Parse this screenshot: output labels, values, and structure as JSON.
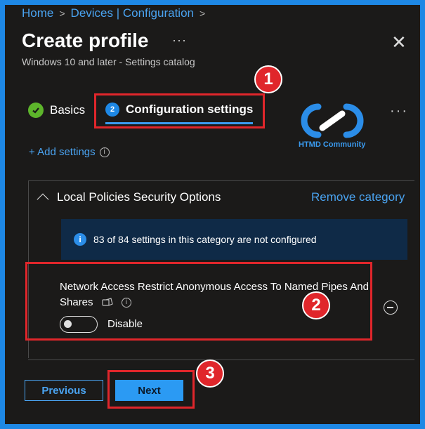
{
  "breadcrumb": {
    "items": [
      "Home",
      "Devices | Configuration"
    ],
    "separator": ">"
  },
  "header": {
    "title": "Create profile",
    "more_label": "···",
    "close_label": "✕",
    "subtitle": "Windows 10 and later - Settings catalog"
  },
  "tabs": [
    {
      "label": "Basics",
      "state": "complete",
      "icon": "check-icon"
    },
    {
      "label": "Configuration settings",
      "number": "2",
      "state": "active"
    }
  ],
  "tabs_more_label": "···",
  "logo": {
    "text": "HTMD Community",
    "icon": "htmd-logo-icon"
  },
  "add_settings": {
    "label": "+ Add settings",
    "info_icon": "info-icon"
  },
  "category": {
    "title": "Local Policies Security Options",
    "remove_label": "Remove category",
    "info_message": "83 of 84 settings in this category are not configured"
  },
  "setting": {
    "label": "Network Access Restrict Anonymous Access To Named Pipes And Shares",
    "toggle_state": "off",
    "toggle_label": "Disable"
  },
  "footer": {
    "previous_label": "Previous",
    "next_label": "Next"
  },
  "callouts": [
    "1",
    "2",
    "3"
  ],
  "colors": {
    "accent": "#2b9af3",
    "annotation_red": "#e0262b",
    "background": "#1b1a19",
    "frame": "#1e88e5"
  }
}
